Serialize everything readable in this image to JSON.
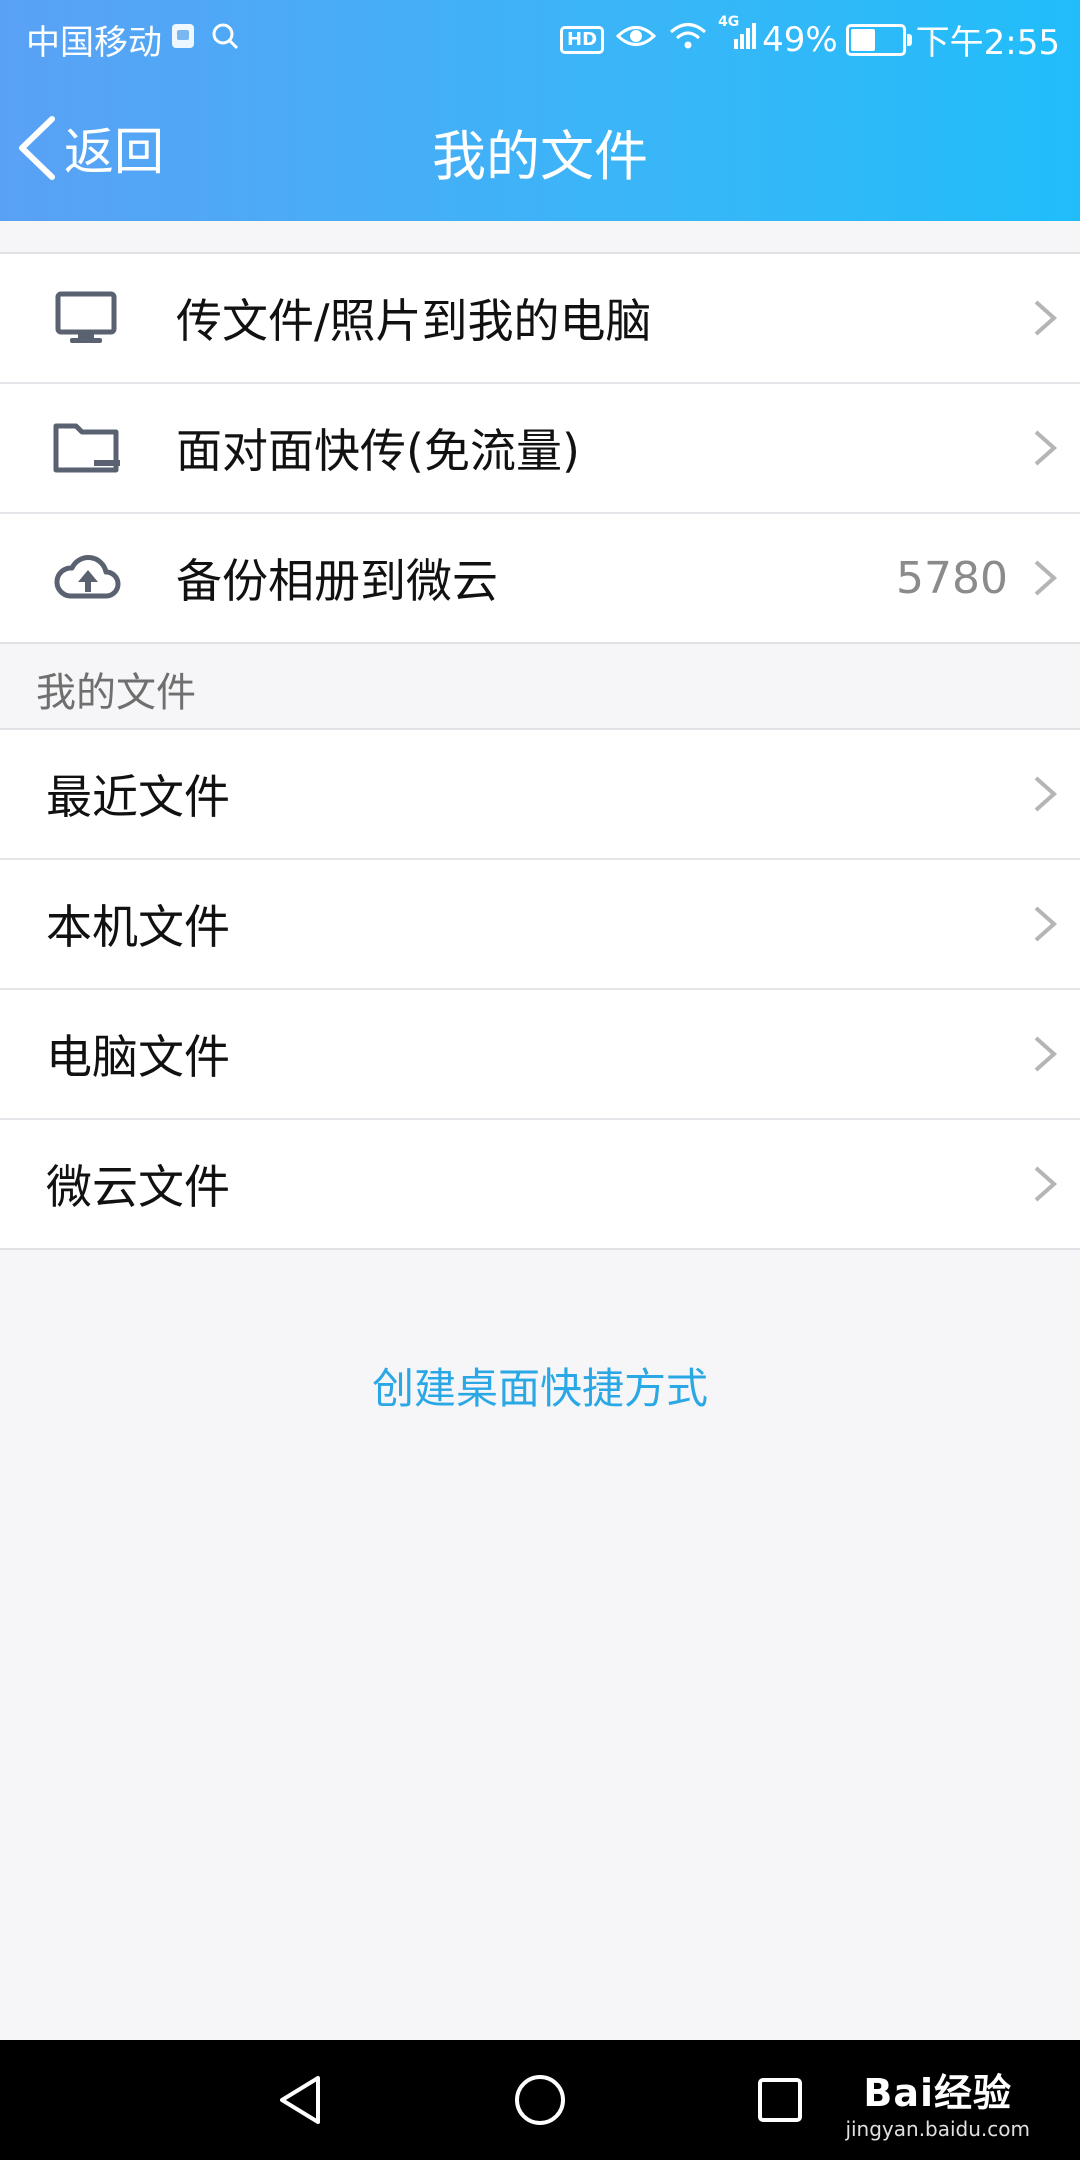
{
  "status_bar": {
    "carrier": "中国移动",
    "network": "4G",
    "battery_percent": "49%",
    "time": "下午2:55"
  },
  "nav": {
    "back_label": "返回",
    "title": "我的文件"
  },
  "top_group": [
    {
      "icon": "monitor-icon",
      "label": "传文件/照片到我的电脑",
      "value": ""
    },
    {
      "icon": "folder-icon",
      "label": "面对面快传(免流量)",
      "value": ""
    },
    {
      "icon": "cloud-upload-icon",
      "label": "备份相册到微云",
      "value": "5780"
    }
  ],
  "section": {
    "label": "我的文件"
  },
  "files_group": [
    {
      "label": "最近文件"
    },
    {
      "label": "本机文件"
    },
    {
      "label": "电脑文件"
    },
    {
      "label": "微云文件"
    }
  ],
  "shortcut_link": "创建桌面快捷方式",
  "watermark": {
    "brand": "Bai经验",
    "url": "jingyan.baidu.com"
  },
  "colors": {
    "header_start": "#5aa1f5",
    "header_end": "#21bdfa",
    "link": "#2aa8e6",
    "icon": "#5a6170"
  }
}
